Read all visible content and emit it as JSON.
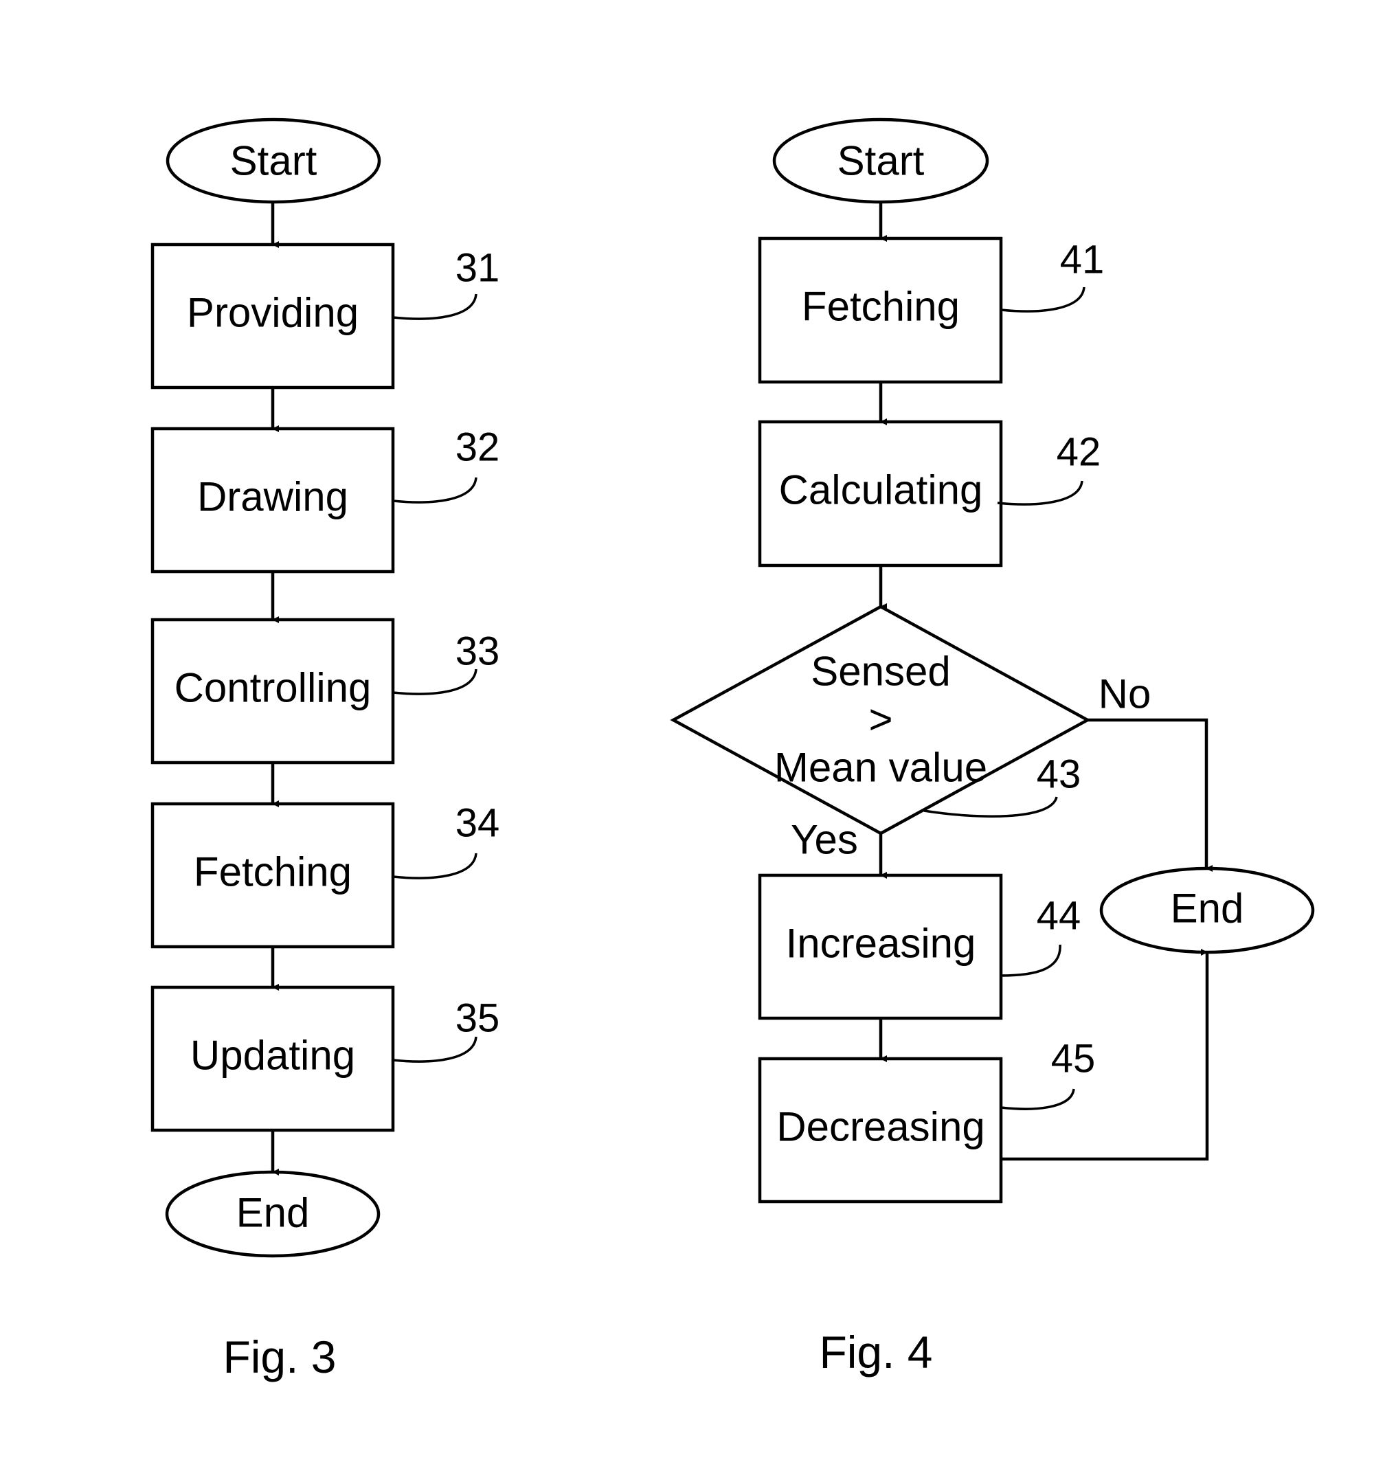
{
  "fig3": {
    "caption": "Fig. 3",
    "start": "Start",
    "end": "End",
    "steps": [
      {
        "label": "Providing",
        "ref": "31"
      },
      {
        "label": "Drawing",
        "ref": "32"
      },
      {
        "label": "Controlling",
        "ref": "33"
      },
      {
        "label": "Fetching",
        "ref": "34"
      },
      {
        "label": "Updating",
        "ref": "35"
      }
    ]
  },
  "fig4": {
    "caption": "Fig. 4",
    "start": "Start",
    "end": "End",
    "steps": [
      {
        "label": "Fetching",
        "ref": "41"
      },
      {
        "label": "Calculating",
        "ref": "42"
      }
    ],
    "decision": {
      "line1": "Sensed",
      "line2": ">",
      "line3": "Mean value",
      "ref": "43",
      "yes": "Yes",
      "no": "No"
    },
    "steps_after": [
      {
        "label": "Increasing",
        "ref": "44"
      },
      {
        "label": "Decreasing",
        "ref": "45"
      }
    ]
  }
}
